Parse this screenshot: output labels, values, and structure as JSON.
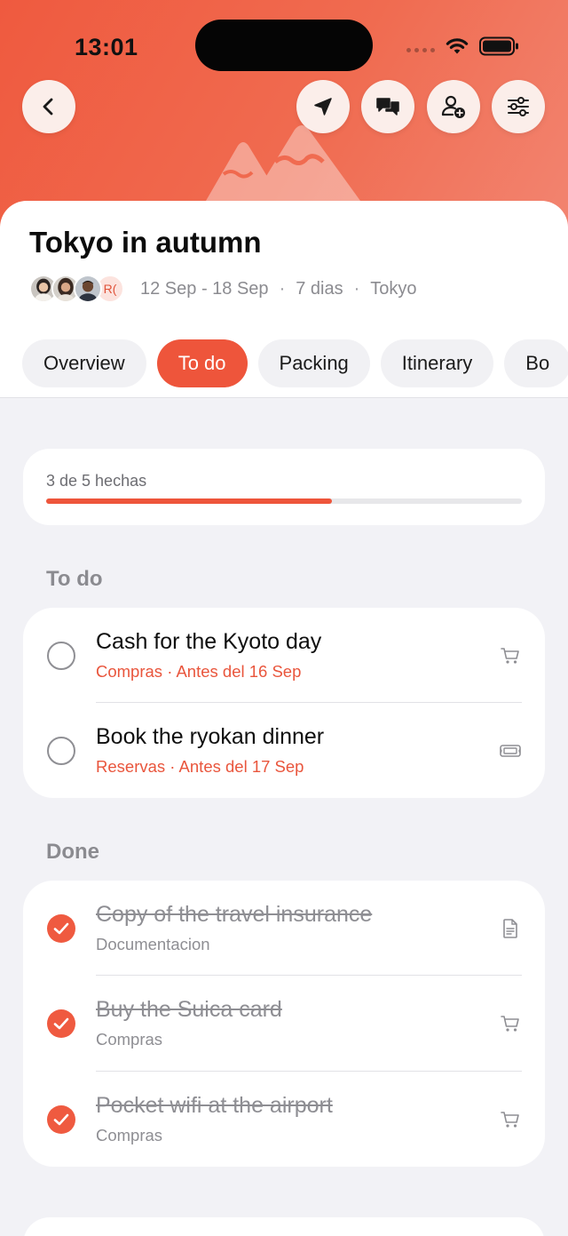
{
  "status_bar": {
    "time": "13:01"
  },
  "trip": {
    "title": "Tokyo in autumn",
    "dates": "12 Sep - 18 Sep",
    "duration": "7 dias",
    "city": "Tokyo",
    "meta_separator": "·",
    "extra_member_initials": "R("
  },
  "header_icons": {
    "back": "chevron-left-icon",
    "navigate": "location-arrow-icon",
    "chat": "chat-bubbles-icon",
    "add_member": "add-person-icon",
    "settings": "sliders-icon"
  },
  "tabs": [
    {
      "label": "Overview",
      "active": false
    },
    {
      "label": "To do",
      "active": true
    },
    {
      "label": "Packing",
      "active": false
    },
    {
      "label": "Itinerary",
      "active": false
    },
    {
      "label": "Bo",
      "active": false
    }
  ],
  "progress": {
    "label": "3 de 5 hechas",
    "completed": 3,
    "total": 5
  },
  "sections": {
    "todo_title": "To do",
    "done_title": "Done"
  },
  "todo_items": [
    {
      "title": "Cash for the Kyoto day",
      "subtitle": "Compras · Antes del 16 Sep",
      "icon": "cart-icon"
    },
    {
      "title": "Book the ryokan dinner",
      "subtitle": "Reservas · Antes del 17 Sep",
      "icon": "ticket-icon"
    }
  ],
  "done_items": [
    {
      "title": "Copy of the travel insurance",
      "subtitle": "Documentacion",
      "icon": "document-icon"
    },
    {
      "title": "Buy the Suica card",
      "subtitle": "Compras",
      "icon": "cart-icon"
    },
    {
      "title": "Pocket wifi at the airport",
      "subtitle": "Compras",
      "icon": "cart-icon"
    }
  ],
  "colors": {
    "accent": "#ee553b",
    "hero_start": "#ef5a3f",
    "hero_end": "#f28470",
    "background": "#f2f2f6",
    "muted_text": "#8e8e93"
  }
}
